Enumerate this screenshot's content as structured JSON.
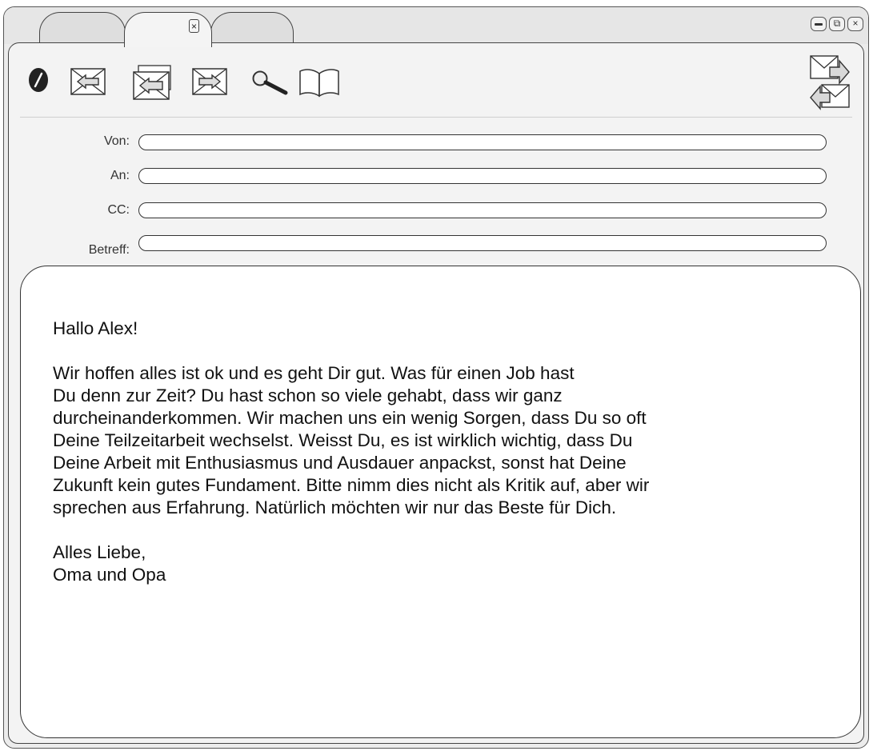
{
  "tabs": [
    {
      "label": ""
    },
    {
      "label": "",
      "close_glyph": "×"
    },
    {
      "label": ""
    }
  ],
  "window_controls": [
    "minimize-icon",
    "restore-icon",
    "close-icon"
  ],
  "window_controls_glyphs": {
    "restore": "⧉",
    "close": "×"
  },
  "toolbar": {
    "icons": [
      "attachment-icon",
      "reply-icon",
      "reply-all-icon",
      "forward-icon",
      "search-icon",
      "address-book-icon",
      "send-receive-icon"
    ]
  },
  "fields": {
    "from": {
      "label": "Von:",
      "value": ""
    },
    "to": {
      "label": "An:",
      "value": ""
    },
    "cc": {
      "label": "CC:",
      "value": ""
    },
    "subject": {
      "label": "Betreff:",
      "value": ""
    }
  },
  "message": {
    "greeting": "Hallo Alex!",
    "body_lines": [
      "Wir hoffen alles ist ok und es geht Dir gut. Was für einen Job hast",
      "Du denn zur Zeit? Du hast schon so viele gehabt, dass wir ganz",
      "durcheinanderkommen. Wir machen uns ein wenig Sorgen, dass Du so oft",
      "Deine Teilzeitarbeit wechselst. Weisst Du, es ist wirklich wichtig, dass Du",
      "Deine Arbeit mit Enthusiasmus und Ausdauer anpackst, sonst hat Deine",
      "Zukunft kein gutes Fundament. Bitte nimm dies nicht als Kritik auf, aber wir",
      "sprechen aus Erfahrung. Natürlich möchten wir nur das Beste für Dich."
    ],
    "closing": "Alles Liebe,",
    "signature": "Oma und Opa"
  }
}
